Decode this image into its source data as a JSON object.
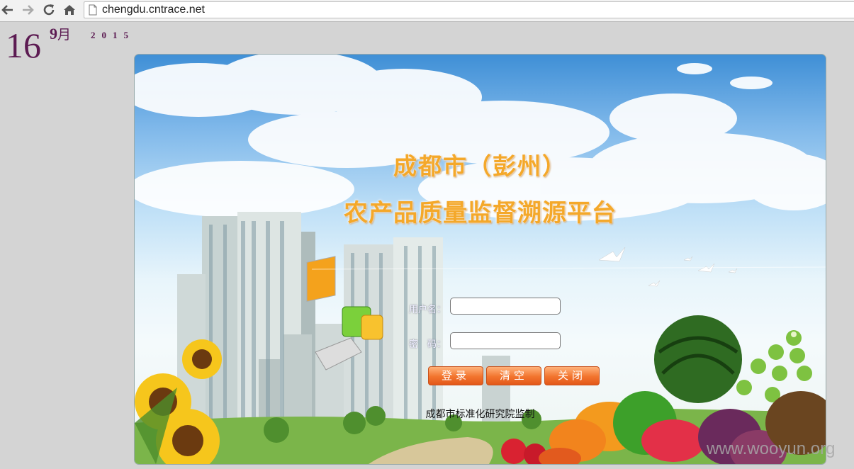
{
  "browser": {
    "url": "chengdu.cntrace.net"
  },
  "date_widget": {
    "day": "16",
    "month": "9",
    "month_suffix": "月",
    "year": "2015"
  },
  "login": {
    "title_line1": "成都市（彭州）",
    "title_line2": "农产品质量监督溯源平台",
    "username_label": "用户名：",
    "username_value": "",
    "password_label": "密　码：",
    "password_value": "",
    "buttons": {
      "login": "登录",
      "clear": "清空",
      "close": "关闭"
    },
    "footer": "成都市标准化研究院监制"
  },
  "watermark": "www.wooyun.org",
  "colors": {
    "title": "#f4a82a",
    "button": "#f2742e",
    "date": "#5c1b52"
  }
}
